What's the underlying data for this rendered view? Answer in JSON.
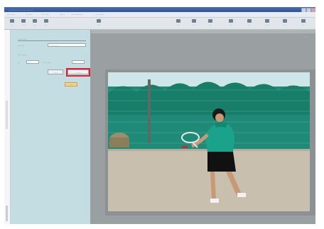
{
  "window": {
    "title": "..........................."
  },
  "menu": {
    "items": [
      "..........",
      "........",
      "..........",
      "......",
      "..............",
      "............"
    ]
  },
  "toolbar": {
    "buttons": [
      "....",
      "......",
      "....",
      "....",
      "....",
      "....",
      "......",
      "....",
      "....",
      "....",
      "......",
      "....",
      "...."
    ]
  },
  "panel": {
    "title": "..........",
    "label_1": "........",
    "field_1": "...............",
    "label_2": "............",
    "label_3": "...",
    "field_3": "....",
    "label_4": "..........",
    "field_4": "....",
    "button_1": "......",
    "button_2": "........",
    "button_3": "...."
  },
  "main": {
    "zoom_readout": "...."
  }
}
